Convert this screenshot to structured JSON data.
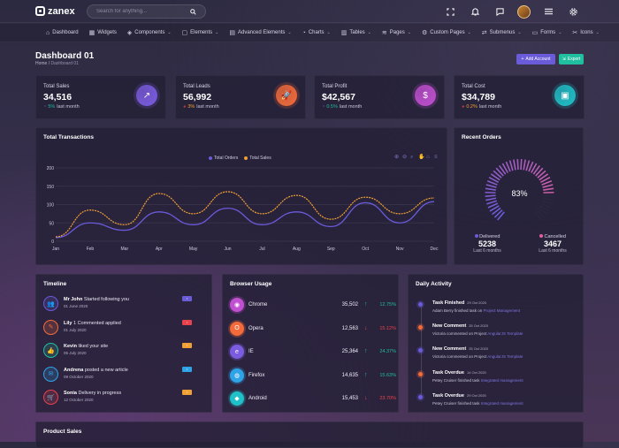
{
  "app": {
    "name": "zanex"
  },
  "search": {
    "placeholder": "Search for anything..."
  },
  "topbar_icons": [
    "fullscreen-icon",
    "bell-icon",
    "message-icon",
    "avatar",
    "menu-icon",
    "gear-icon"
  ],
  "nav": {
    "items": [
      {
        "label": "Dashboard",
        "icon": "home-icon",
        "caret": false
      },
      {
        "label": "Widgets",
        "icon": "grid-icon",
        "caret": false
      },
      {
        "label": "Components",
        "icon": "layers-icon",
        "caret": true
      },
      {
        "label": "Elements",
        "icon": "box-icon",
        "caret": true
      },
      {
        "label": "Advanced Elements",
        "icon": "file-icon",
        "caret": true
      },
      {
        "label": "Charts",
        "icon": "pie-icon",
        "caret": true
      },
      {
        "label": "Tables",
        "icon": "clipboard-icon",
        "caret": true
      },
      {
        "label": "Pages",
        "icon": "stack-icon",
        "caret": true
      },
      {
        "label": "Custom Pages",
        "icon": "settings-icon",
        "caret": true
      },
      {
        "label": "Submenus",
        "icon": "shuffle-icon",
        "caret": true
      },
      {
        "label": "Forms",
        "icon": "form-icon",
        "caret": true
      },
      {
        "label": "Icons",
        "icon": "tools-icon",
        "caret": true
      }
    ]
  },
  "header": {
    "title": "Dashboard 01",
    "breadcrumb_home": "Home",
    "breadcrumb_sep": "/",
    "breadcrumb_current": "Dashboard 01",
    "add_account": "Add Account",
    "export": "Export"
  },
  "stats": [
    {
      "label": "Total Sales",
      "value": "34,516",
      "change": "5%",
      "suffix": "last month",
      "dir": "up",
      "icon": "trend-icon",
      "color": "#7b5ce0"
    },
    {
      "label": "Total Leads",
      "value": "56,992",
      "change": "3%",
      "suffix": "last month",
      "dir": "down",
      "icon": "rocket-icon",
      "color": "#f36b3b"
    },
    {
      "label": "Total Profit",
      "value": "$42,567",
      "change": "0.5%",
      "suffix": "last month",
      "dir": "up",
      "icon": "dollar-icon",
      "color": "#c14fd1"
    },
    {
      "label": "Total Cost",
      "value": "$34,789",
      "change": "0.2%",
      "suffix": "last month",
      "dir": "down",
      "icon": "briefcase-icon",
      "color": "#20c0c8"
    }
  ],
  "transactions": {
    "title": "Total Transactions",
    "chart_data": {
      "type": "line",
      "categories": [
        "Jan",
        "Feb",
        "Mar",
        "Apr",
        "May",
        "Jun",
        "Jul",
        "Aug",
        "Sep",
        "Oct",
        "Nov",
        "Dec"
      ],
      "ylim": [
        0,
        200
      ],
      "yticks": [
        "0",
        "50",
        "100",
        "150",
        "200"
      ],
      "series": [
        {
          "name": "Total Orders",
          "color": "#6a5bd9",
          "values": [
            10,
            50,
            30,
            80,
            45,
            90,
            45,
            80,
            40,
            105,
            50,
            108
          ]
        },
        {
          "name": "Total Sales",
          "color": "#f1a035",
          "values": [
            12,
            85,
            45,
            130,
            75,
            135,
            75,
            125,
            60,
            120,
            75,
            118
          ]
        }
      ]
    }
  },
  "recent_orders": {
    "title": "Recent Orders",
    "percent": "83%",
    "percent_value": 0.83,
    "delivered": {
      "label": "Delivered",
      "value": "5238",
      "sub": "Last 6 months"
    },
    "cancelled": {
      "label": "Cancelled",
      "value": "3467",
      "sub": "Last 6 months"
    }
  },
  "timeline": {
    "title": "Timeline",
    "items": [
      {
        "name": "Mr John",
        "text": "Started following you",
        "date": "01 June 2020",
        "badge_color": "#6a5bd9",
        "icon_color": "#6a5bd9",
        "icon": "user-plus-icon"
      },
      {
        "name": "Lily",
        "text": "1 Commented applied",
        "date": "01 July 2020",
        "badge_color": "#e8424c",
        "icon_color": "#f36b3b",
        "icon": "comment-icon"
      },
      {
        "name": "Kevin",
        "text": "liked your site",
        "date": "05 July 2020",
        "badge_color": "#f1a035",
        "icon_color": "#1fbf9f",
        "icon": "thumb-icon"
      },
      {
        "name": "Andrena",
        "text": "posted a new article",
        "date": "09 October 2020",
        "badge_color": "#2fa3e8",
        "icon_color": "#2fa3e8",
        "icon": "mail-icon"
      },
      {
        "name": "Sonia",
        "text": "Delivery in progress",
        "date": "12 October 2020",
        "badge_color": "#f1a035",
        "icon_color": "#e8424c",
        "icon": "cart-icon"
      }
    ]
  },
  "browser_usage": {
    "title": "Browser Usage",
    "items": [
      {
        "name": "Chrome",
        "value": "35,502",
        "pct": "12.75%",
        "dir": "up",
        "color": "#c14fd1",
        "icon": "chrome-icon"
      },
      {
        "name": "Opera",
        "value": "12,563",
        "pct": "15.12%",
        "dir": "down",
        "color": "#f36b3b",
        "icon": "opera-icon"
      },
      {
        "name": "IE",
        "value": "25,364",
        "pct": "24.37%",
        "dir": "up",
        "color": "#7b5ce0",
        "icon": "ie-icon"
      },
      {
        "name": "Firefox",
        "value": "14,635",
        "pct": "15.63%",
        "dir": "up",
        "color": "#2fa3e8",
        "icon": "firefox-icon"
      },
      {
        "name": "Android",
        "value": "15,453",
        "pct": "23.70%",
        "dir": "down",
        "color": "#20c0c8",
        "icon": "android-icon"
      }
    ]
  },
  "daily_activity": {
    "title": "Daily Activity",
    "items": [
      {
        "title": "Task Finished",
        "date": "29 Oct 2020",
        "desc": "Adam Berry finished task on",
        "link": "Project Management",
        "color": "#6a5bd9"
      },
      {
        "title": "New Comment",
        "date": "25 Oct 2020",
        "desc": "Victoria commented on Project",
        "link": "AngularJS Template",
        "color": "#f36b3b"
      },
      {
        "title": "New Comment",
        "date": "25 Oct 2020",
        "desc": "Victoria commented on Project",
        "link": "AngularJS Template",
        "color": "#6a5bd9"
      },
      {
        "title": "Task Overdue",
        "date": "14 Oct 2020",
        "desc": "Petey Cruiser finished task",
        "link": "Integrated management",
        "color": "#f36b3b"
      },
      {
        "title": "Task Overdue",
        "date": "29 Oct 2020",
        "desc": "Petey Cruiser finished task",
        "link": "Integrated management",
        "color": "#6a5bd9"
      }
    ]
  },
  "product_sales": {
    "title": "Product Sales"
  }
}
